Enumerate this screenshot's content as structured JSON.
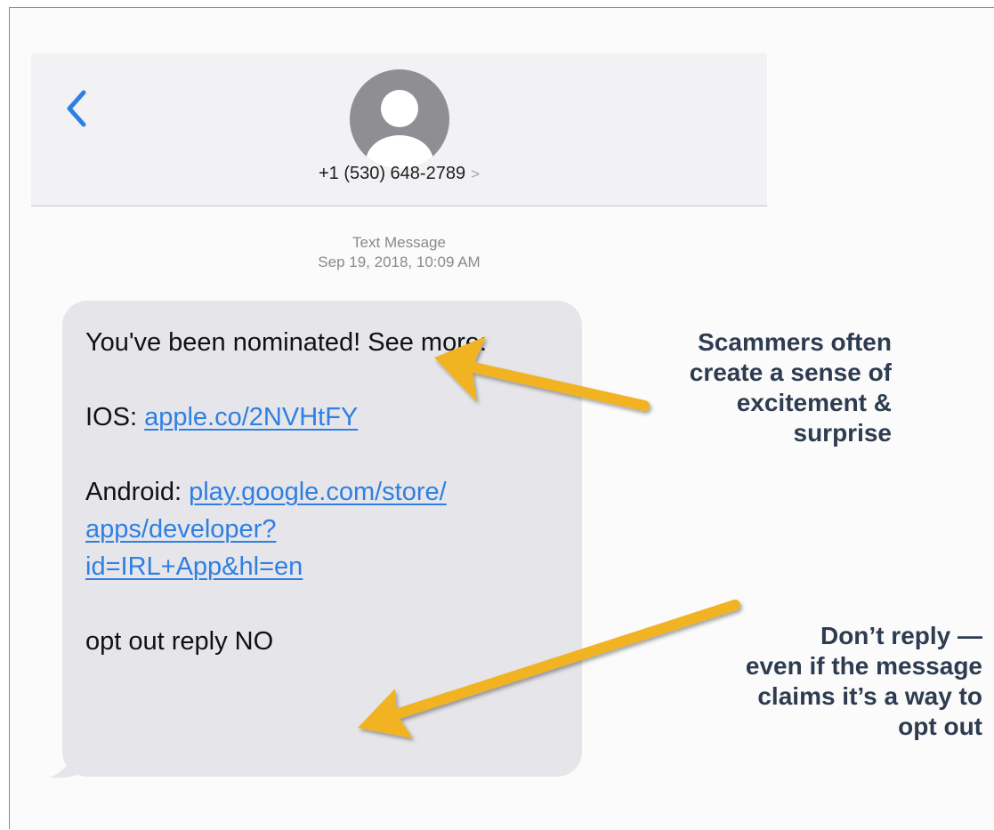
{
  "header": {
    "contact": "+1 (530) 648-2789",
    "contact_chevron": ">"
  },
  "conversation": {
    "kind": "Text Message",
    "timestamp": "Sep 19, 2018, 10:09 AM"
  },
  "message": {
    "line1": "You've been nominated! See more:",
    "ios_prefix": "IOS: ",
    "ios_link": "apple.co/2NVHtFY",
    "android_prefix": "Android: ",
    "android_link_1": "play.google.com/store/",
    "android_link_2": "apps/developer?",
    "android_link_3": "id=IRL+App&hl=en",
    "opt_out": "opt out reply NO"
  },
  "annotations": {
    "excitement": [
      "Scammers often",
      "create a sense of",
      "excitement &",
      "surprise"
    ],
    "dont_reply": [
      "Don’t  reply —",
      "even if the message",
      "claims it’s a way to",
      "opt out"
    ]
  },
  "colors": {
    "link": "#2f7fe3",
    "bubble": "#e6e6ea",
    "arrow": "#f2b320",
    "annotation_text": "#2e3c50",
    "ios_blue": "#2f7fe3"
  },
  "icons": [
    "chevron-left-icon",
    "contact-avatar-icon",
    "chevron-right-icon",
    "arrow-icon"
  ]
}
